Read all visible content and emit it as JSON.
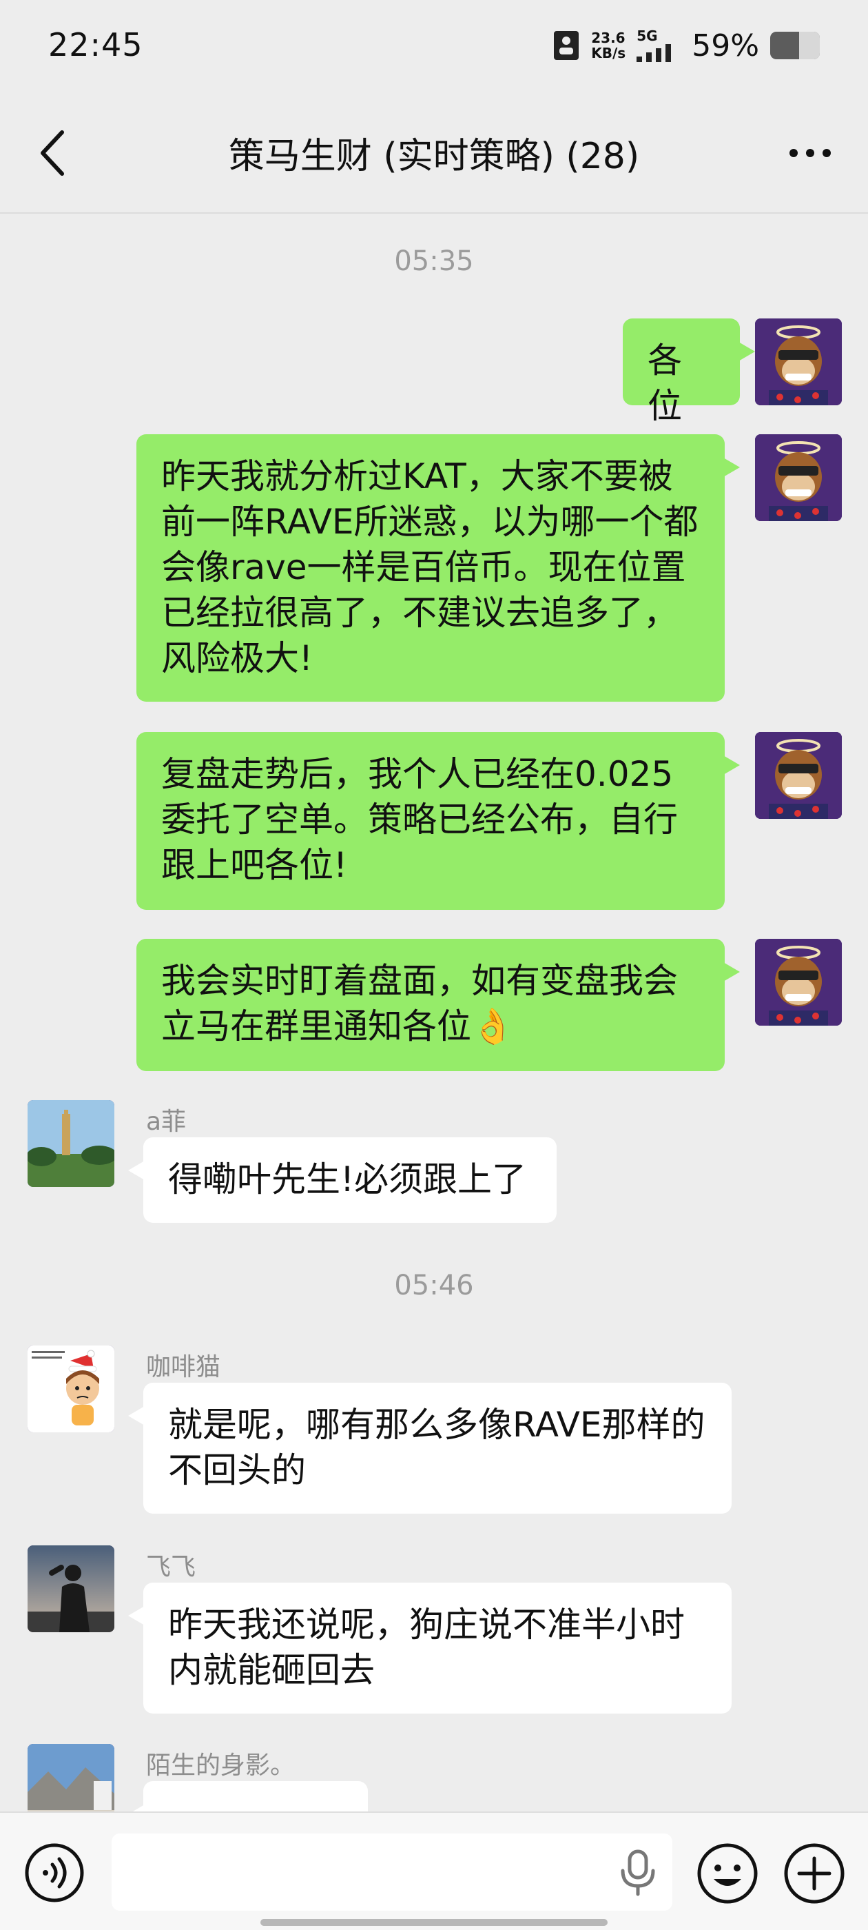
{
  "status_bar": {
    "time": "22:45",
    "speed_value": "23.6",
    "speed_unit": "KB/s",
    "network": "5G",
    "battery_percent": "59%",
    "battery_level": 0.59
  },
  "header": {
    "title": "策马生财 (实时策略) (28)"
  },
  "messages": {
    "ts1": "05:35",
    "m1": "各位",
    "m2": "昨天我就分析过KAT，大家不要被前一阵RAVE所迷惑，以为哪一个都会像rave一样是百倍币。现在位置已经拉很高了，不建议去追多了，风险极大!",
    "m3": "复盘走势后，我个人已经在0.025委托了空单。策略已经公布，自行跟上吧各位!",
    "m4": "我会实时盯着盘面，如有变盘我会立马在群里通知各位👌",
    "s5": "a菲",
    "m5": "得嘞叶先生!必须跟上了",
    "ts2": "05:46",
    "s6": "咖啡猫",
    "m6": "就是呢，哪有那么多像RAVE那样的不回头的",
    "s7": "飞飞",
    "m7": "昨天我还说呢，狗庄说不准半小时内就能砸回去",
    "s8": "陌生的身影。"
  },
  "icons": {
    "back": "chevron-left-icon",
    "more": "more-dots-icon",
    "voice": "voice-icon",
    "mic": "microphone-icon",
    "emoji": "emoji-icon",
    "plus": "plus-icon"
  },
  "colors": {
    "outgoing_bubble": "#95ec69",
    "incoming_bubble": "#ffffff",
    "background": "#ededed"
  }
}
